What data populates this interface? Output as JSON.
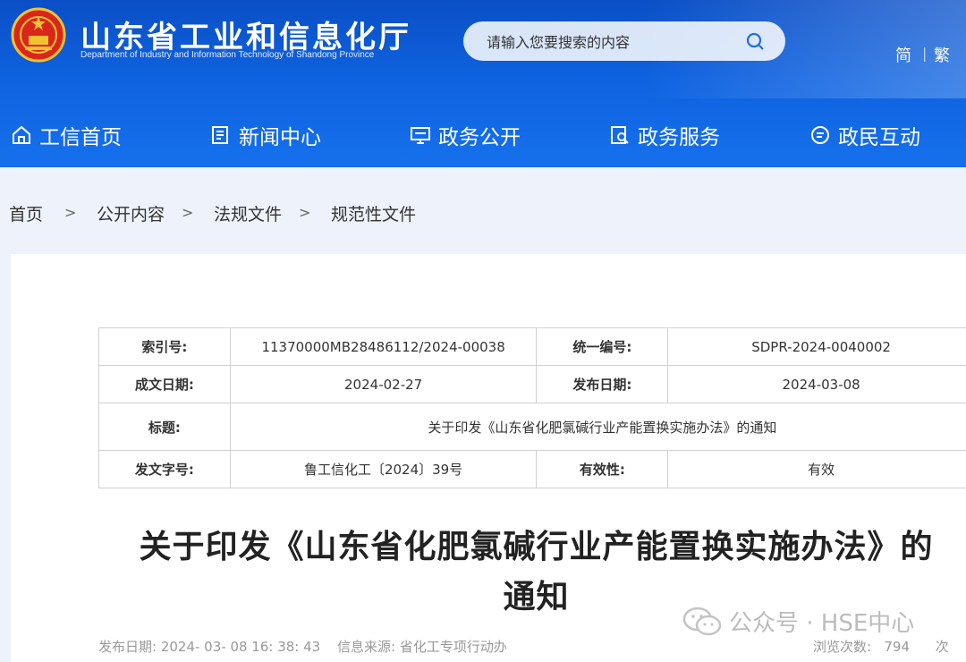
{
  "header": {
    "title": "山东省工业和信息化厅",
    "subtitle": "Department of Industry and Information Technology of Shandong Province",
    "search_placeholder": "请输入您要搜索的内容",
    "lang_simplified": "简",
    "lang_separator": "|",
    "lang_traditional": "繁"
  },
  "nav": [
    {
      "label": "工信首页",
      "icon": "home-icon"
    },
    {
      "label": "新闻中心",
      "icon": "news-icon"
    },
    {
      "label": "政务公开",
      "icon": "monitor-icon"
    },
    {
      "label": "政务服务",
      "icon": "document-search-icon"
    },
    {
      "label": "政民互动",
      "icon": "chat-icon"
    }
  ],
  "breadcrumb": [
    "首页",
    "公开内容",
    "法规文件",
    "规范性文件"
  ],
  "breadcrumb_sep": ">",
  "meta": {
    "index_label": "索引号:",
    "index_value": "11370000MB28486112/2024-00038",
    "code_label": "统一编号:",
    "code_value": "SDPR-2024-0040002",
    "written_label": "成文日期:",
    "written_value": "2024-02-27",
    "publish_label": "发布日期:",
    "publish_value": "2024-03-08",
    "title_label": "标题:",
    "title_value": "关于印发《山东省化肥氯碱行业产能置换实施办法》的通知",
    "docno_label": "发文字号:",
    "docno_value": "鲁工信化工〔2024〕39号",
    "validity_label": "有效性:",
    "validity_value": "有效"
  },
  "doc_title_line1": "关于印发《山东省化肥氯碱行业产能置换实施办法》的",
  "doc_title_line2": "通知",
  "footer": {
    "publish": "发布日期: 2024- 03- 08 16: 38: 43",
    "source": "信息来源: 省化工专项行动办",
    "views": "浏览次数:   794      次"
  },
  "watermark": "公众号 · HSE中心",
  "colors": {
    "header_blue": "#0f63e0",
    "page_bg": "#eef3fb"
  }
}
